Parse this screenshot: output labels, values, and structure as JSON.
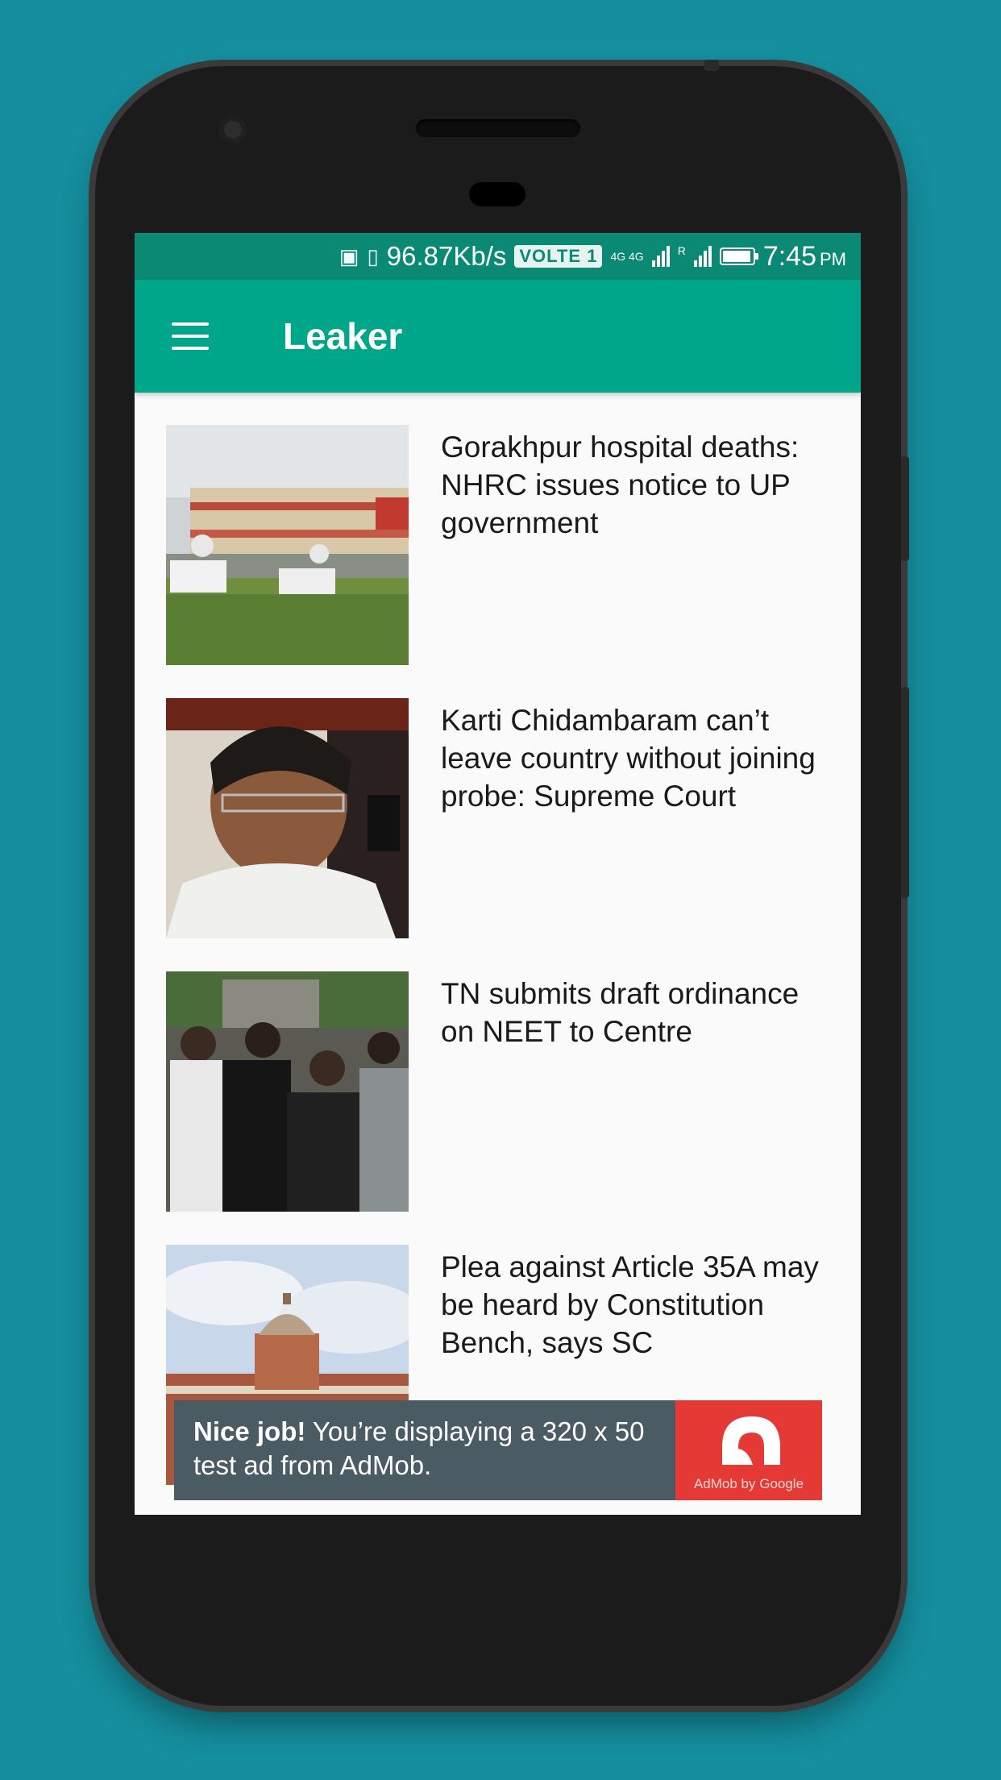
{
  "status_bar": {
    "speed": "96.87Kb/s",
    "volte": "VOLTE 1",
    "net1": "4G 4G",
    "net2": "R",
    "time": "7:45",
    "ampm": "PM"
  },
  "app_bar": {
    "title": "Leaker"
  },
  "feed": {
    "items": [
      {
        "headline": "Gorakhpur hospital deaths: NHRC issues notice to UP government"
      },
      {
        "headline": "Karti Chidambaram can’t leave country without joining probe: Supreme Court"
      },
      {
        "headline": "TN submits draft ordinance on NEET to Centre"
      },
      {
        "headline": "Plea against Article 35A may be heard by Constitution Bench, says SC"
      }
    ]
  },
  "ad": {
    "bold": "Nice job!",
    "text": " You’re displaying a 320 x 50 test ad from AdMob.",
    "logo_caption": "AdMob by Google"
  },
  "colors": {
    "background": "#158e9e",
    "status_bar": "#0a8a75",
    "app_bar": "#00a68a",
    "ad_background": "#4a5b63",
    "ad_logo": "#e53935"
  }
}
